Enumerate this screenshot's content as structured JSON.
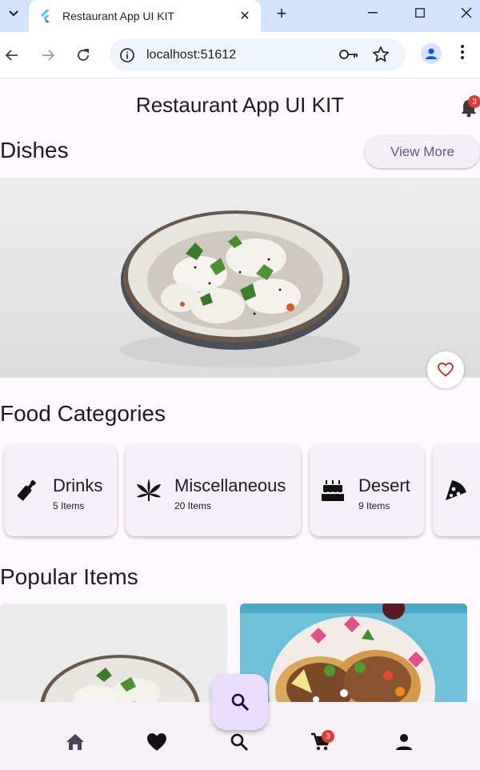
{
  "browser": {
    "tab_title": "Restaurant App UI KIT",
    "url": "localhost:51612"
  },
  "app": {
    "title": "Restaurant App UI KIT",
    "notification_count": "3",
    "dishes": {
      "title": "Dishes",
      "view_more_label": "View More"
    },
    "food_categories": {
      "title": "Food Categories",
      "items": [
        {
          "name": "Drinks",
          "count": "5 Items",
          "icon": "bottle-icon"
        },
        {
          "name": "Miscellaneous",
          "count": "20 Items",
          "icon": "cannabis-leaf-icon"
        },
        {
          "name": "Desert",
          "count": "9 Items",
          "icon": "cake-icon"
        },
        {
          "name": "",
          "count": "",
          "icon": "pizza-slice-icon"
        }
      ]
    },
    "popular_items": {
      "title": "Popular Items"
    },
    "bottom_nav": {
      "items": [
        "home-icon",
        "heart-icon",
        "search-icon",
        "cart-icon",
        "person-icon"
      ],
      "cart_count": "3"
    },
    "colors": {
      "accent": "#65558f",
      "fab": "#eaddff",
      "badge": "#e53935",
      "card": "#f5eff7"
    }
  }
}
